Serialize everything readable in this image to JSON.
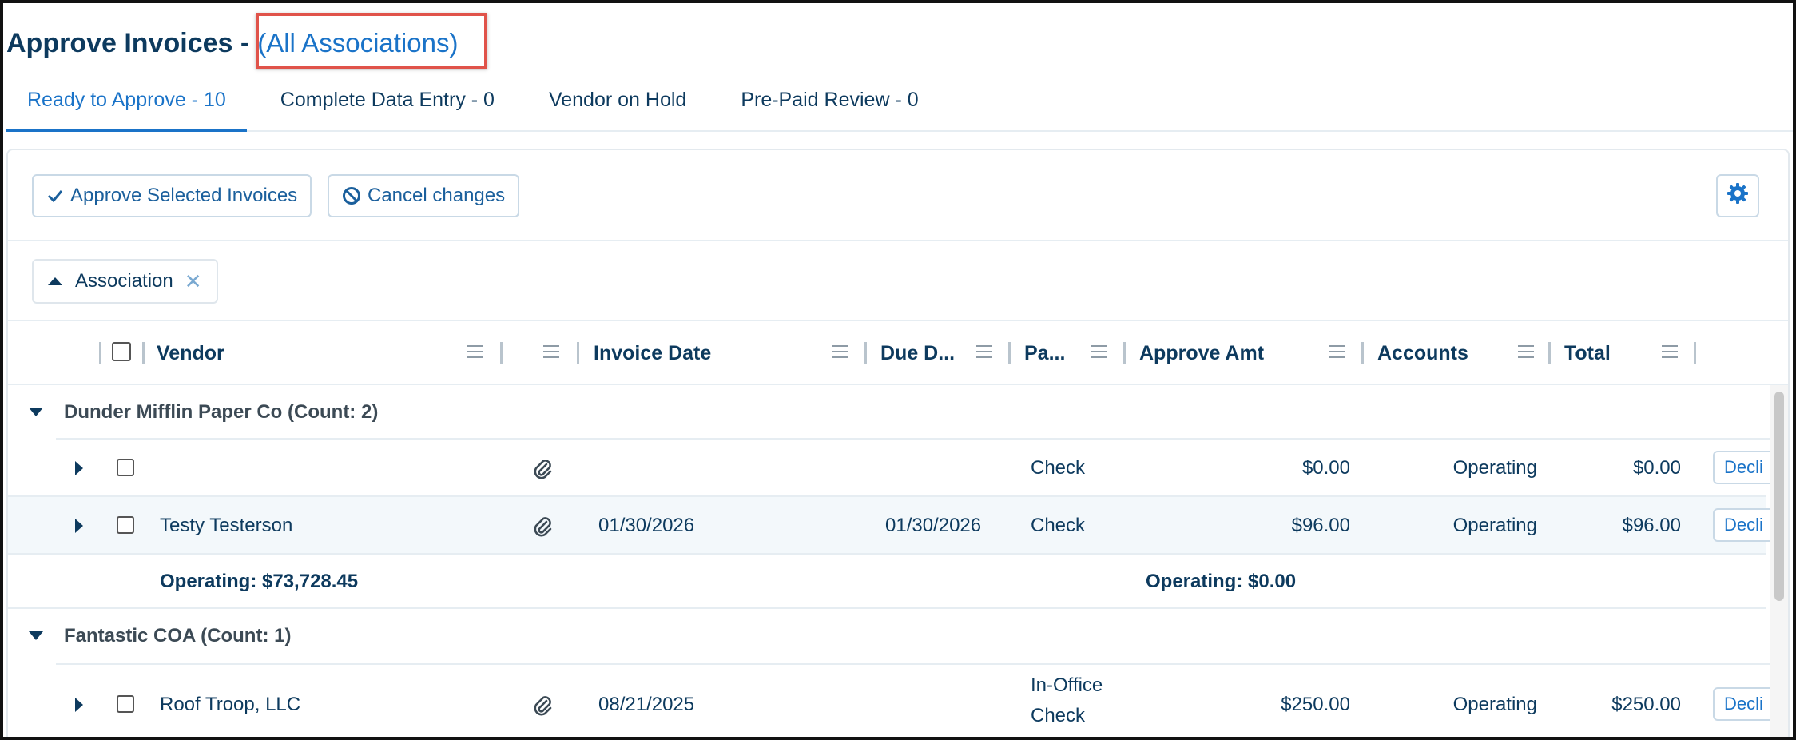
{
  "title": {
    "main": "Approve Invoices -",
    "link": "(All Associations)"
  },
  "tabs": [
    {
      "label": "Ready to Approve - 10",
      "active": true
    },
    {
      "label": "Complete Data Entry - 0",
      "active": false
    },
    {
      "label": "Vendor on Hold",
      "active": false
    },
    {
      "label": "Pre-Paid Review - 0",
      "active": false
    }
  ],
  "toolbar": {
    "approve_label": "Approve Selected Invoices",
    "cancel_label": "Cancel changes",
    "settings_icon": "gear-icon"
  },
  "grouping": {
    "chip_label": "Association"
  },
  "columns": {
    "vendor": "Vendor",
    "invoice_date": "Invoice Date",
    "due_date": "Due D...",
    "pay": "Pa...",
    "approve_amt": "Approve Amt",
    "accounts": "Accounts",
    "total": "Total"
  },
  "groups": [
    {
      "title": "Dunder Mifflin Paper Co (Count: 2)",
      "rows": [
        {
          "vendor": "",
          "invoice_date": "",
          "due_date": "",
          "pay": "Check",
          "approve_amt": "$0.00",
          "accounts": "Operating",
          "total": "$0.00",
          "action": "Decli"
        },
        {
          "vendor": "Testy Testerson",
          "invoice_date": "01/30/2026",
          "due_date": "01/30/2026",
          "pay": "Check",
          "approve_amt": "$96.00",
          "accounts": "Operating",
          "total": "$96.00",
          "action": "Decli"
        }
      ],
      "summary_left": "Operating: $73,728.45",
      "summary_right": "Operating: $0.00"
    },
    {
      "title": "Fantastic COA (Count: 1)",
      "rows": [
        {
          "vendor": "Roof Troop, LLC",
          "invoice_date": "08/21/2025",
          "due_date": "",
          "pay_line1": "In-Office",
          "pay_line2": "Check",
          "approve_amt": "$250.00",
          "accounts": "Operating",
          "total": "$250.00",
          "action": "Decli"
        }
      ]
    }
  ],
  "colors": {
    "accent": "#1a73c8",
    "text": "#0d3a5e",
    "highlight": "#e0534a"
  }
}
